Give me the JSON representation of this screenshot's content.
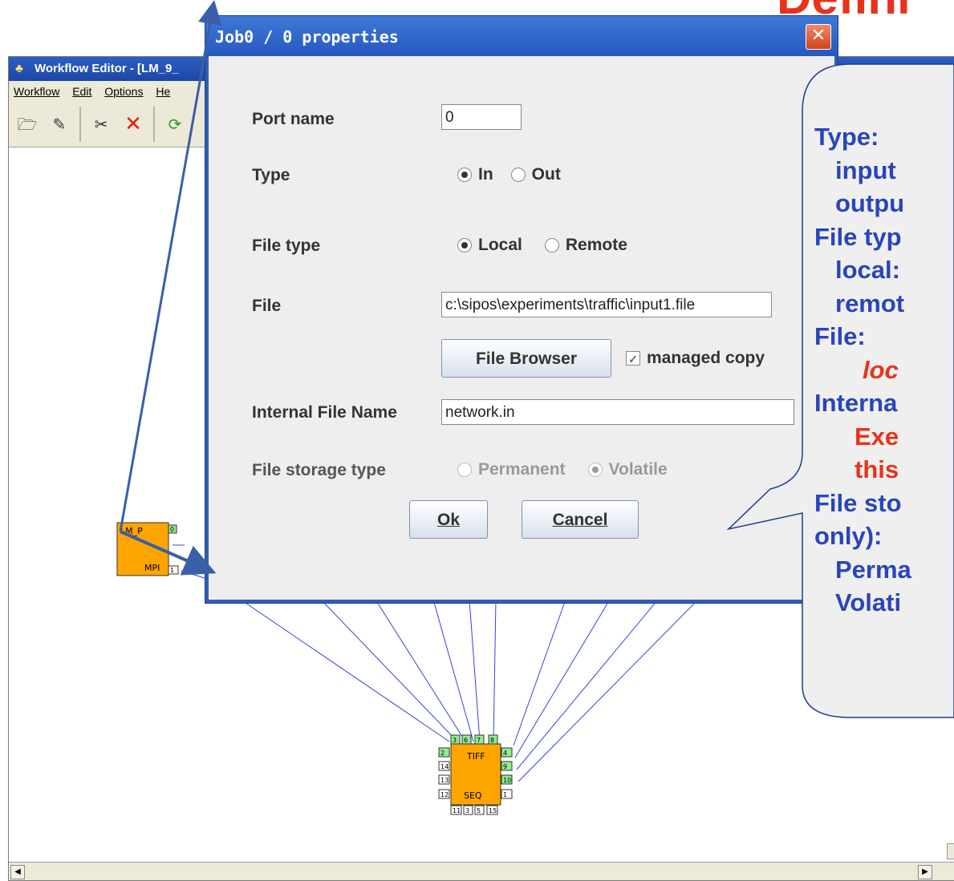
{
  "slide": {
    "title": "Defini"
  },
  "editor": {
    "title": "Workflow Editor - [LM_9_",
    "menu": [
      "Workflow",
      "Edit",
      "Options",
      "He"
    ],
    "toolbar_icons": [
      "open-icon",
      "save-icon",
      "cut-icon",
      "delete-icon",
      "refresh-icon"
    ]
  },
  "graph": {
    "job1": {
      "top_label": "LM_P",
      "bottom_label": "MPI",
      "port_out": "0",
      "port_in": "1"
    },
    "job2": {
      "top_label": "TIFF",
      "bottom_label": "SEQ",
      "top_ports": [
        "3",
        "6",
        "7",
        "8"
      ],
      "left_ports": [
        "2",
        "14",
        "13",
        "12"
      ],
      "right_ports": [
        "4",
        "9",
        "10",
        "1"
      ],
      "bottom_ports": [
        "11",
        "3",
        "5",
        "15"
      ]
    }
  },
  "dialog": {
    "title": "Job0 / 0 properties",
    "port_name_label": "Port name",
    "port_name_value": "0",
    "type_label": "Type",
    "type_in": "In",
    "type_out": "Out",
    "file_type_label": "File type",
    "file_type_local": "Local",
    "file_type_remote": "Remote",
    "file_label": "File",
    "file_value": "c:\\sipos\\experiments\\traffic\\input1.file",
    "file_browser_label": "File Browser",
    "managed_copy_label": "managed copy",
    "internal_file_name_label": "Internal File Name",
    "internal_file_name_value": "network.in",
    "file_storage_type_label": "File storage type",
    "storage_permanent": "Permanent",
    "storage_volatile": "Volatile",
    "ok_label": "Ok",
    "cancel_label": "Cancel"
  },
  "callout": {
    "lines": [
      "Type:",
      "input",
      "outpu",
      "File typ",
      "local:",
      "remot",
      "File:",
      "loc",
      "Interna",
      "Exe",
      "this",
      "File sto",
      "only):",
      "Perma",
      "Volati"
    ]
  },
  "colors": {
    "accent_blue": "#2a45b8",
    "accent_red": "#e8331a",
    "job_orange": "#ffa500",
    "port_green": "#90ee90"
  }
}
